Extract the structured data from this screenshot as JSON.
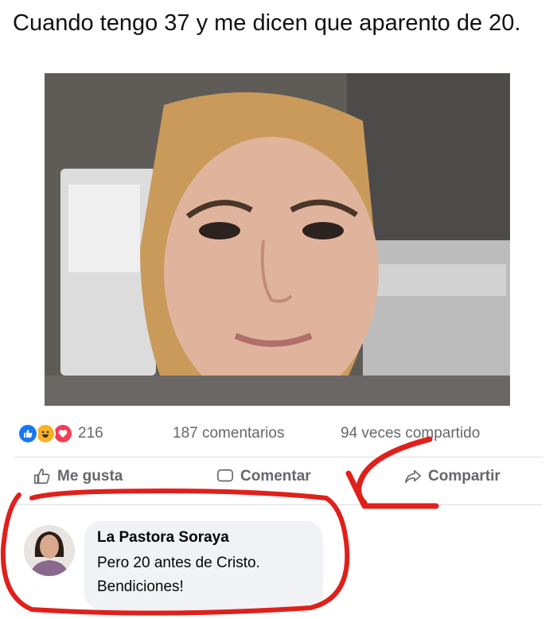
{
  "caption": "Cuando tengo 37 y me dicen que aparento de 20.",
  "post": {
    "reaction_icons": [
      "like-icon",
      "haha-icon",
      "love-icon"
    ],
    "reaction_count": "216",
    "comments_count": "187 comentarios",
    "shares_count": "94 veces compartido"
  },
  "actions": {
    "like": "Me gusta",
    "comment": "Comentar",
    "share": "Compartir"
  },
  "comment": {
    "author": "La Pastora Soraya",
    "line1": "Pero 20 antes de Cristo.",
    "line2": "Bendiciones!"
  },
  "colors": {
    "annotation_red": "#e0201b",
    "like_blue": "#1877f2",
    "bubble_gray": "#f0f2f5"
  }
}
